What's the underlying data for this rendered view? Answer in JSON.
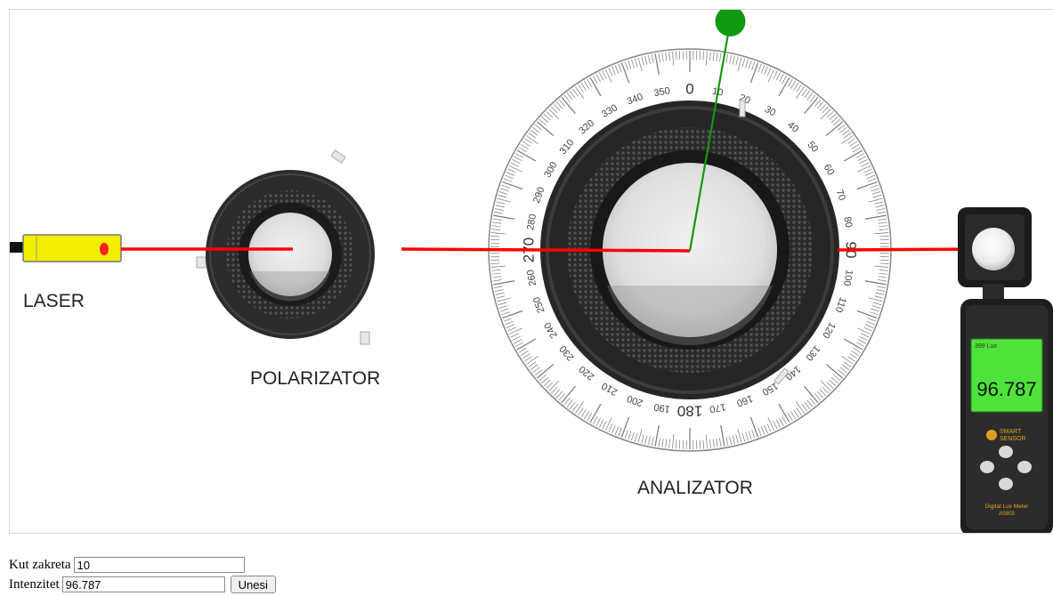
{
  "labels": {
    "laser": "LASER",
    "polarizator": "POLARIZATOR",
    "analizator": "ANALIZATOR"
  },
  "analyzer": {
    "rotation_degrees": 10,
    "scale_labels": [
      "0",
      "10",
      "20",
      "30",
      "40",
      "50",
      "60",
      "70",
      "80",
      "90",
      "100",
      "110",
      "120",
      "130",
      "140",
      "150",
      "160",
      "170",
      "180",
      "190",
      "200",
      "210",
      "220",
      "230",
      "240",
      "250",
      "260",
      "270",
      "280",
      "290",
      "300",
      "310",
      "320",
      "330",
      "340",
      "350"
    ]
  },
  "lux_meter": {
    "display_value": "96.787",
    "brand_line1": "SMART",
    "brand_line2": "SENSOR",
    "model_line1": "Digital Lux Meter",
    "model_line2": "AS803",
    "screen_color": "#4ee23a"
  },
  "colors": {
    "beam": "#ff0000",
    "pointer": "#119911",
    "laser_body": "#f1ee00"
  },
  "form": {
    "angle_label": "Kut zakreta",
    "angle_value": "10",
    "intensity_label": "Intenzitet",
    "intensity_value": "96.787",
    "submit_label": "Unesi"
  }
}
